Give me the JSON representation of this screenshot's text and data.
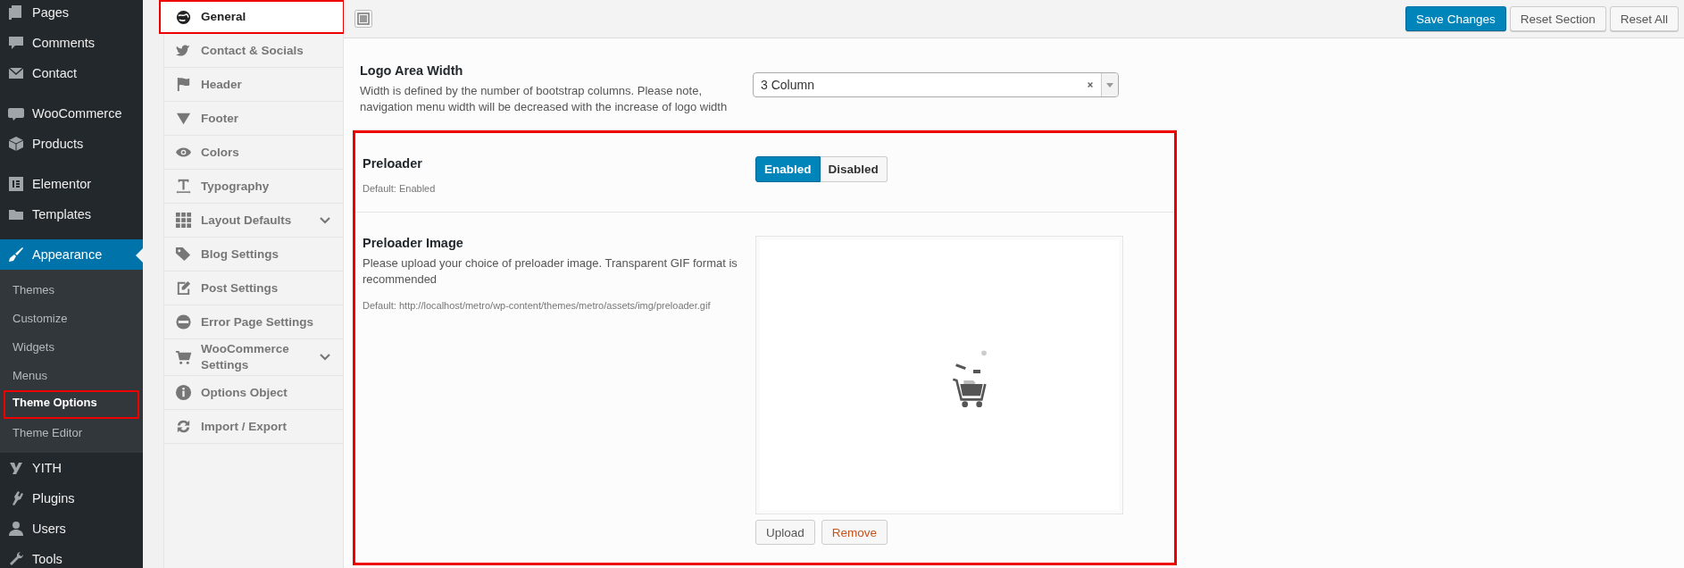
{
  "admin_menu": {
    "groups": [
      {
        "items": [
          {
            "label": "Pages",
            "selected": false
          },
          {
            "label": "Comments",
            "selected": false
          },
          {
            "label": "Contact",
            "selected": false
          }
        ]
      },
      {
        "items": [
          {
            "label": "WooCommerce",
            "selected": false
          },
          {
            "label": "Products",
            "selected": false
          }
        ]
      },
      {
        "items": [
          {
            "label": "Elementor",
            "selected": false
          },
          {
            "label": "Templates",
            "selected": false
          }
        ]
      },
      {
        "items": [
          {
            "label": "Appearance",
            "selected": true,
            "submenu": [
              {
                "label": "Themes",
                "selected": false,
                "highlighted": false
              },
              {
                "label": "Customize",
                "selected": false,
                "highlighted": false
              },
              {
                "label": "Widgets",
                "selected": false,
                "highlighted": false
              },
              {
                "label": "Menus",
                "selected": false,
                "highlighted": false
              },
              {
                "label": "Theme Options",
                "selected": true,
                "highlighted": true
              },
              {
                "label": "Theme Editor",
                "selected": false,
                "highlighted": false
              }
            ]
          },
          {
            "label": "YITH",
            "selected": false
          },
          {
            "label": "Plugins",
            "selected": false
          },
          {
            "label": "Users",
            "selected": false
          },
          {
            "label": "Tools",
            "selected": false
          }
        ]
      }
    ]
  },
  "options_menu": [
    {
      "label": "General",
      "selected": true,
      "expandable": false,
      "highlighted": true
    },
    {
      "label": "Contact & Socials",
      "selected": false,
      "expandable": false,
      "highlighted": false
    },
    {
      "label": "Header",
      "selected": false,
      "expandable": false,
      "highlighted": false
    },
    {
      "label": "Footer",
      "selected": false,
      "expandable": false,
      "highlighted": false
    },
    {
      "label": "Colors",
      "selected": false,
      "expandable": false,
      "highlighted": false
    },
    {
      "label": "Typography",
      "selected": false,
      "expandable": false,
      "highlighted": false
    },
    {
      "label": "Layout Defaults",
      "selected": false,
      "expandable": true,
      "highlighted": false
    },
    {
      "label": "Blog Settings",
      "selected": false,
      "expandable": false,
      "highlighted": false
    },
    {
      "label": "Post Settings",
      "selected": false,
      "expandable": false,
      "highlighted": false
    },
    {
      "label": "Error Page Settings",
      "selected": false,
      "expandable": false,
      "highlighted": false
    },
    {
      "label": "WooCommerce Settings",
      "selected": false,
      "expandable": true,
      "highlighted": false
    },
    {
      "label": "Options Object",
      "selected": false,
      "expandable": false,
      "highlighted": false
    },
    {
      "label": "Import / Export",
      "selected": false,
      "expandable": false,
      "highlighted": false
    }
  ],
  "toolbar": {
    "buttons": [
      {
        "label": "Save Changes",
        "kind": "primary"
      },
      {
        "label": "Reset Section",
        "kind": "secondary"
      },
      {
        "label": "Reset All",
        "kind": "secondary"
      }
    ]
  },
  "sections": [
    {
      "highlighted": false,
      "fields": [
        {
          "kind": "select",
          "title": "Logo Area Width",
          "description": "Width is defined by the number of bootstrap columns. Please note, navigation menu width will be decreased with the increase of logo width",
          "value": "3 Column"
        }
      ]
    },
    {
      "highlighted": true,
      "fields": [
        {
          "kind": "toggle",
          "title": "Preloader",
          "default": "Default: Enabled",
          "options": [
            {
              "label": "Enabled",
              "selected": true
            },
            {
              "label": "Disabled",
              "selected": false
            }
          ]
        },
        {
          "kind": "media",
          "title": "Preloader Image",
          "description": "Please upload your choice of preloader image. Transparent GIF format is recommended",
          "default": "Default: http://localhost/metro/wp-content/themes/metro/assets/img/preloader.gif",
          "preview": {
            "kind": "picture"
          },
          "buttons": [
            {
              "label": "Upload",
              "kind": "upload"
            },
            {
              "label": "Remove",
              "kind": "remove"
            }
          ]
        }
      ]
    }
  ]
}
